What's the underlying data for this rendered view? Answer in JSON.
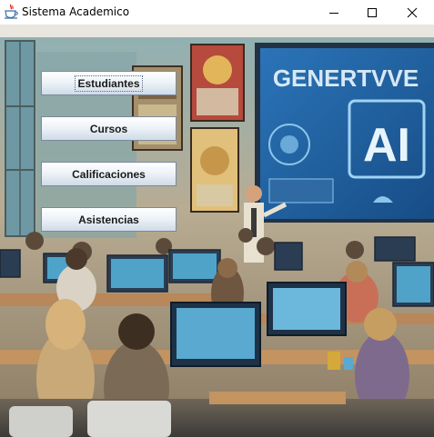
{
  "window": {
    "title": "Sistema Academico",
    "icon": "java-coffee-cup-icon",
    "controls": [
      "minimize-icon",
      "maximize-icon",
      "close-icon"
    ]
  },
  "menu": {
    "buttons": [
      {
        "label": "Estudiantes",
        "focused": true
      },
      {
        "label": "Cursos",
        "focused": false
      },
      {
        "label": "Calificaciones",
        "focused": false
      },
      {
        "label": "Asistencias",
        "focused": false
      }
    ]
  },
  "background": {
    "screen_text_top": "GENERTVVE",
    "screen_text_big": "AI"
  },
  "colors": {
    "sky_teal": "#5b9aa6",
    "screen_blue": "#1f5fa0",
    "wall_beige": "#c8b494",
    "desk_wood": "#b98b56"
  }
}
